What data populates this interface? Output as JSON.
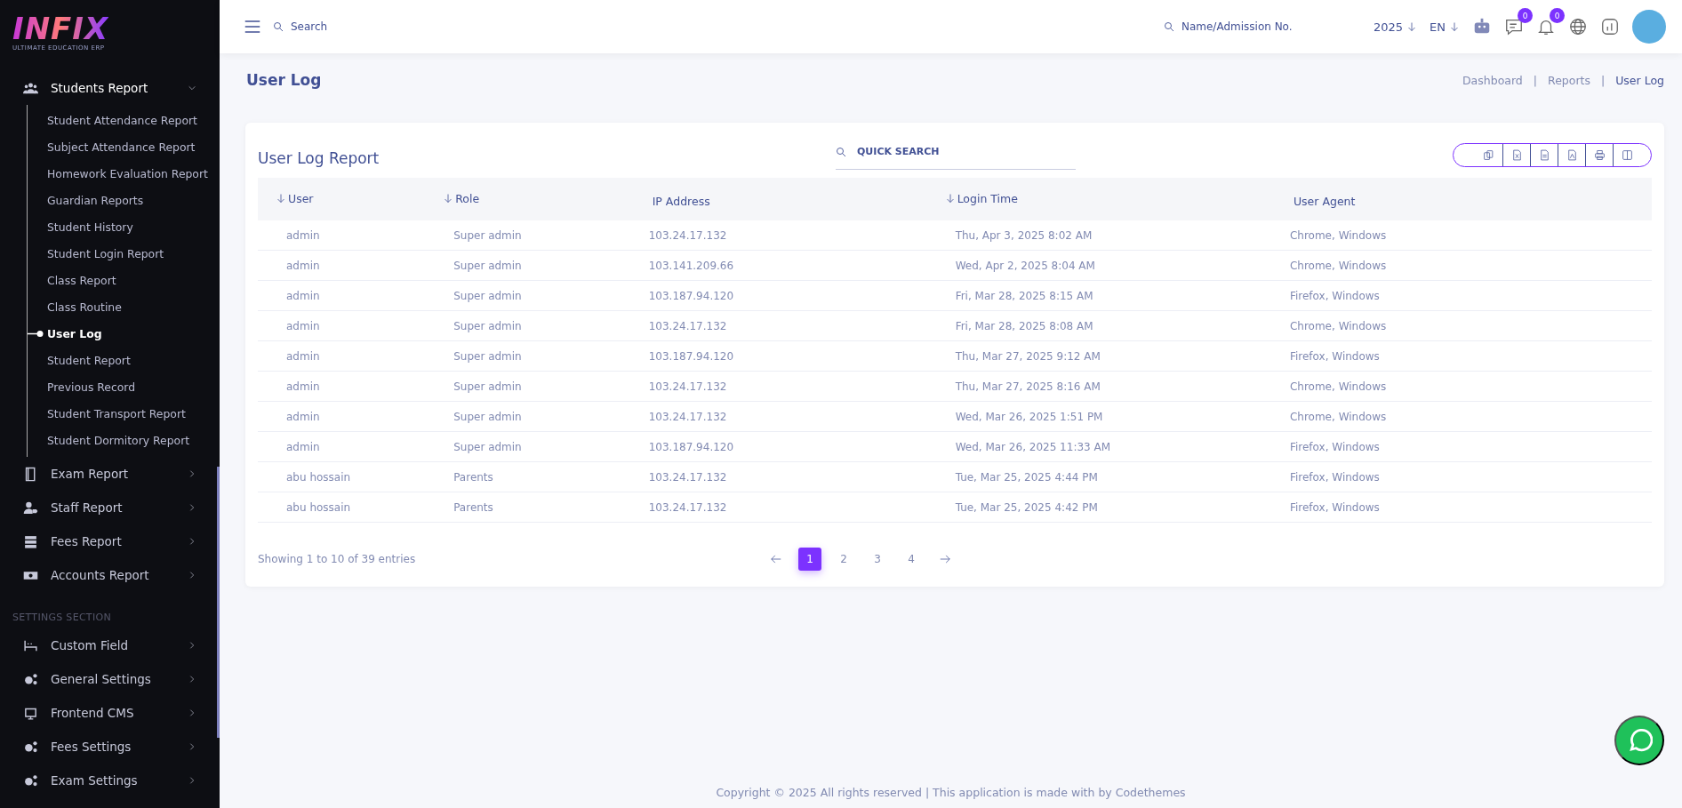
{
  "sidebar": {
    "logo": {
      "text": "INFIX",
      "tagline": "ULTIMATE EDUCATION ERP"
    },
    "groups": [
      {
        "items": [
          {
            "label": "Students Report",
            "expanded": true,
            "children": [
              {
                "label": "Student Attendance Report",
                "selected": false
              },
              {
                "label": "Subject Attendance Report",
                "selected": false
              },
              {
                "label": "Homework Evaluation Report",
                "selected": false
              },
              {
                "label": "Guardian Reports",
                "selected": false
              },
              {
                "label": "Student History",
                "selected": false
              },
              {
                "label": "Student Login Report",
                "selected": false
              },
              {
                "label": "Class Report",
                "selected": false
              },
              {
                "label": "Class Routine",
                "selected": false
              },
              {
                "label": "User Log",
                "selected": true
              },
              {
                "label": "Student Report",
                "selected": false
              },
              {
                "label": "Previous Record",
                "selected": false
              },
              {
                "label": "Student Transport Report",
                "selected": false
              },
              {
                "label": "Student Dormitory Report",
                "selected": false
              }
            ]
          },
          {
            "label": "Exam Report",
            "expanded": false
          },
          {
            "label": "Staff Report",
            "expanded": false
          },
          {
            "label": "Fees Report",
            "expanded": false
          },
          {
            "label": "Accounts Report",
            "expanded": false
          }
        ]
      },
      {
        "heading": "SETTINGS SECTION",
        "items": [
          {
            "label": "Custom Field",
            "expanded": false
          },
          {
            "label": "General Settings",
            "expanded": false
          },
          {
            "label": "Frontend CMS",
            "expanded": false
          },
          {
            "label": "Fees Settings",
            "expanded": false
          },
          {
            "label": "Exam Settings",
            "expanded": false
          }
        ]
      }
    ]
  },
  "topbar": {
    "search": {
      "placeholder": "Search"
    },
    "student_search": {
      "placeholder": "Name/Admission No."
    },
    "year": "2025",
    "language": "EN",
    "chat_badge": "0",
    "notification_badge": "0"
  },
  "page": {
    "title": "User Log",
    "breadcrumbs": {
      "separator": "|",
      "items": [
        {
          "label": "Dashboard",
          "current": false
        },
        {
          "label": "Reports",
          "current": false
        },
        {
          "label": "User Log",
          "current": true
        }
      ]
    }
  },
  "card": {
    "title": "User Log Report",
    "quick_search": {
      "placeholder": "QUICK SEARCH"
    },
    "table": {
      "columns": [
        {
          "label": "User",
          "sortable": true
        },
        {
          "label": "Role",
          "sortable": true
        },
        {
          "label": "IP Address",
          "sortable": false
        },
        {
          "label": "Login Time",
          "sortable": true
        },
        {
          "label": "User Agent",
          "sortable": false
        }
      ],
      "rows": [
        [
          "admin",
          "Super admin",
          "103.24.17.132",
          "Thu, Apr 3, 2025 8:02 AM",
          "Chrome, Windows"
        ],
        [
          "admin",
          "Super admin",
          "103.141.209.66",
          "Wed, Apr 2, 2025 8:04 AM",
          "Chrome, Windows"
        ],
        [
          "admin",
          "Super admin",
          "103.187.94.120",
          "Fri, Mar 28, 2025 8:15 AM",
          "Firefox, Windows"
        ],
        [
          "admin",
          "Super admin",
          "103.24.17.132",
          "Fri, Mar 28, 2025 8:08 AM",
          "Chrome, Windows"
        ],
        [
          "admin",
          "Super admin",
          "103.187.94.120",
          "Thu, Mar 27, 2025 9:12 AM",
          "Firefox, Windows"
        ],
        [
          "admin",
          "Super admin",
          "103.24.17.132",
          "Thu, Mar 27, 2025 8:16 AM",
          "Chrome, Windows"
        ],
        [
          "admin",
          "Super admin",
          "103.24.17.132",
          "Wed, Mar 26, 2025 1:51 PM",
          "Chrome, Windows"
        ],
        [
          "admin",
          "Super admin",
          "103.187.94.120",
          "Wed, Mar 26, 2025 11:33 AM",
          "Firefox, Windows"
        ],
        [
          "abu hossain",
          "Parents",
          "103.24.17.132",
          "Tue, Mar 25, 2025 4:44 PM",
          "Firefox, Windows"
        ],
        [
          "abu hossain",
          "Parents",
          "103.24.17.132",
          "Tue, Mar 25, 2025 4:42 PM",
          "Firefox, Windows"
        ]
      ]
    },
    "info": "Showing 1 to 10 of 39 entries",
    "pages": [
      {
        "label": "1",
        "selected": true
      },
      {
        "label": "2",
        "selected": false
      },
      {
        "label": "3",
        "selected": false
      },
      {
        "label": "4",
        "selected": false
      }
    ]
  },
  "footer": "Copyright © 2025 All rights reserved | This application is made with by Codethemes"
}
